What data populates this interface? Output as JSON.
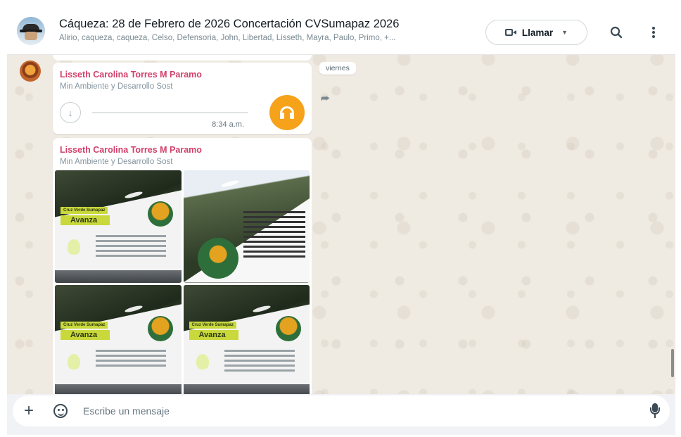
{
  "header": {
    "title": "Cáqueza: 28 de Febrero de 2026 Concertación CVSumapaz 2026",
    "members": "Alirio, caqueza, caqueza, Celso, Defensoria, John, Libertad, Lisseth, Mayra, Paulo, Primo, +...",
    "call_label": "Llamar",
    "icons": {
      "search": "search-icon",
      "menu": "more-vert-icon",
      "call": "video-camera-icon"
    }
  },
  "messages": [
    {
      "sender": "Lisseth Carolina Torres M Paramo",
      "role": "Min Ambiente y Desarrollo Sost",
      "type": "audio",
      "time": "8:34 a.m."
    },
    {
      "sender": "Lisseth Carolina Torres M Paramo",
      "role": "Min Ambiente y Desarrollo Sost",
      "type": "images",
      "tiles": [
        {
          "tag": "Cruz Verde Sumapaz",
          "title": "Avanza"
        },
        {
          "tag": "",
          "title": ""
        },
        {
          "tag": "Cruz Verde Sumapaz",
          "title": "Avanza"
        },
        {
          "tag": "Cruz Verde Sumapaz",
          "title": "Avanza"
        }
      ]
    }
  ],
  "day_chip": "viernes",
  "composer": {
    "placeholder": "Escribe un mensaje"
  },
  "colors": {
    "sender_name": "#d1406a",
    "audio_accent": "#f7a21b",
    "chat_bg": "#efeae2"
  }
}
